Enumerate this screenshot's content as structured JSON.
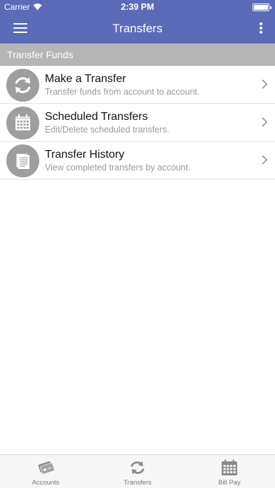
{
  "status_bar": {
    "carrier": "Carrier",
    "time": "2:39 PM"
  },
  "nav": {
    "title": "Transfers"
  },
  "section": {
    "header": "Transfer Funds"
  },
  "list": {
    "items": [
      {
        "icon": "refresh-arrows-icon",
        "title": "Make a Transfer",
        "subtitle": "Transfer funds from account to account."
      },
      {
        "icon": "calendar-icon",
        "title": "Scheduled Transfers",
        "subtitle": "Edit/Delete scheduled transfers."
      },
      {
        "icon": "document-icon",
        "title": "Transfer History",
        "subtitle": "View completed transfers by account."
      }
    ]
  },
  "tabs": [
    {
      "icon": "cards-icon",
      "label": "Accounts"
    },
    {
      "icon": "refresh-arrows-icon",
      "label": "Transfers"
    },
    {
      "icon": "calendar-icon",
      "label": "Bill Pay"
    }
  ],
  "colors": {
    "nav_bar": "#5b6bb8",
    "section_header": "#b5b5b5",
    "icon_circle": "#9e9e9e",
    "tab_icon": "#8a8a8a"
  }
}
